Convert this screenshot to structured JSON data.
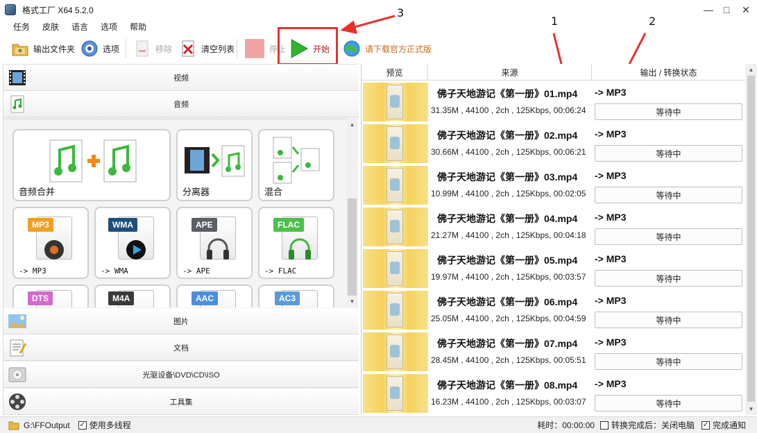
{
  "window": {
    "title": "格式工厂 X64 5.2.0"
  },
  "menu": [
    "任务",
    "皮肤",
    "语言",
    "选项",
    "帮助"
  ],
  "toolbar": {
    "output_folder": "输出文件夹",
    "options": "选项",
    "remove": "移除",
    "clear_list": "清空列表",
    "stop": "停止",
    "start": "开始",
    "download": "请下载官方正式版"
  },
  "annotations": [
    "1",
    "2",
    "3"
  ],
  "categories": {
    "video": "视频",
    "audio": "音频",
    "image": "图片",
    "document": "文档",
    "rom": "光驱设备\\DVD\\CD\\ISO",
    "tools": "工具集"
  },
  "tiles": {
    "merge": "音频合并",
    "splitter": "分离器",
    "mix": "混合",
    "mp3": "-> MP3",
    "wma": "-> WMA",
    "ape": "-> APE",
    "flac": "-> FLAC",
    "badges": {
      "mp3": "MP3",
      "wma": "WMA",
      "ape": "APE",
      "flac": "FLAC",
      "dts": "DTS",
      "m4a": "M4A",
      "aac": "AAC",
      "ac3": "AC3"
    }
  },
  "table": {
    "headers": [
      "预览",
      "来源",
      "输出 / 转换状态"
    ],
    "rows": [
      {
        "name": "佛子天地游记《第一册》01.mp4",
        "info": "31.35M , 44100 , 2ch , 125Kbps, 00:06:24",
        "target": "-> MP3",
        "status": "等待中"
      },
      {
        "name": "佛子天地游记《第一册》02.mp4",
        "info": "30.66M , 44100 , 2ch , 125Kbps, 00:06:21",
        "target": "-> MP3",
        "status": "等待中"
      },
      {
        "name": "佛子天地游记《第一册》03.mp4",
        "info": "10.99M , 44100 , 2ch , 125Kbps, 00:02:05",
        "target": "-> MP3",
        "status": "等待中"
      },
      {
        "name": "佛子天地游记《第一册》04.mp4",
        "info": "21.27M , 44100 , 2ch , 125Kbps, 00:04:18",
        "target": "-> MP3",
        "status": "等待中"
      },
      {
        "name": "佛子天地游记《第一册》05.mp4",
        "info": "19.97M , 44100 , 2ch , 125Kbps, 00:03:57",
        "target": "-> MP3",
        "status": "等待中"
      },
      {
        "name": "佛子天地游记《第一册》06.mp4",
        "info": "25.05M , 44100 , 2ch , 125Kbps, 00:04:59",
        "target": "-> MP3",
        "status": "等待中"
      },
      {
        "name": "佛子天地游记《第一册》07.mp4",
        "info": "28.45M , 44100 , 2ch , 125Kbps, 00:05:51",
        "target": "-> MP3",
        "status": "等待中"
      },
      {
        "name": "佛子天地游记《第一册》08.mp4",
        "info": "16.23M , 44100 , 2ch , 125Kbps, 00:03:07",
        "target": "-> MP3",
        "status": "等待中"
      }
    ]
  },
  "statusbar": {
    "output_path": "G:\\FFOutput",
    "multithread": "使用多线程",
    "elapsed": "耗时：00:00:00",
    "after_done": "转换完成后：关闭电脑",
    "notify": "完成通知"
  },
  "colors": {
    "accent_red": "#e8322c",
    "start_green": "#2fb52f",
    "download_orange": "#d2691e"
  },
  "icons": [
    "folder-icon",
    "options-icon",
    "remove-icon",
    "clear-list-icon",
    "stop-icon",
    "play-icon",
    "globe-icon"
  ]
}
